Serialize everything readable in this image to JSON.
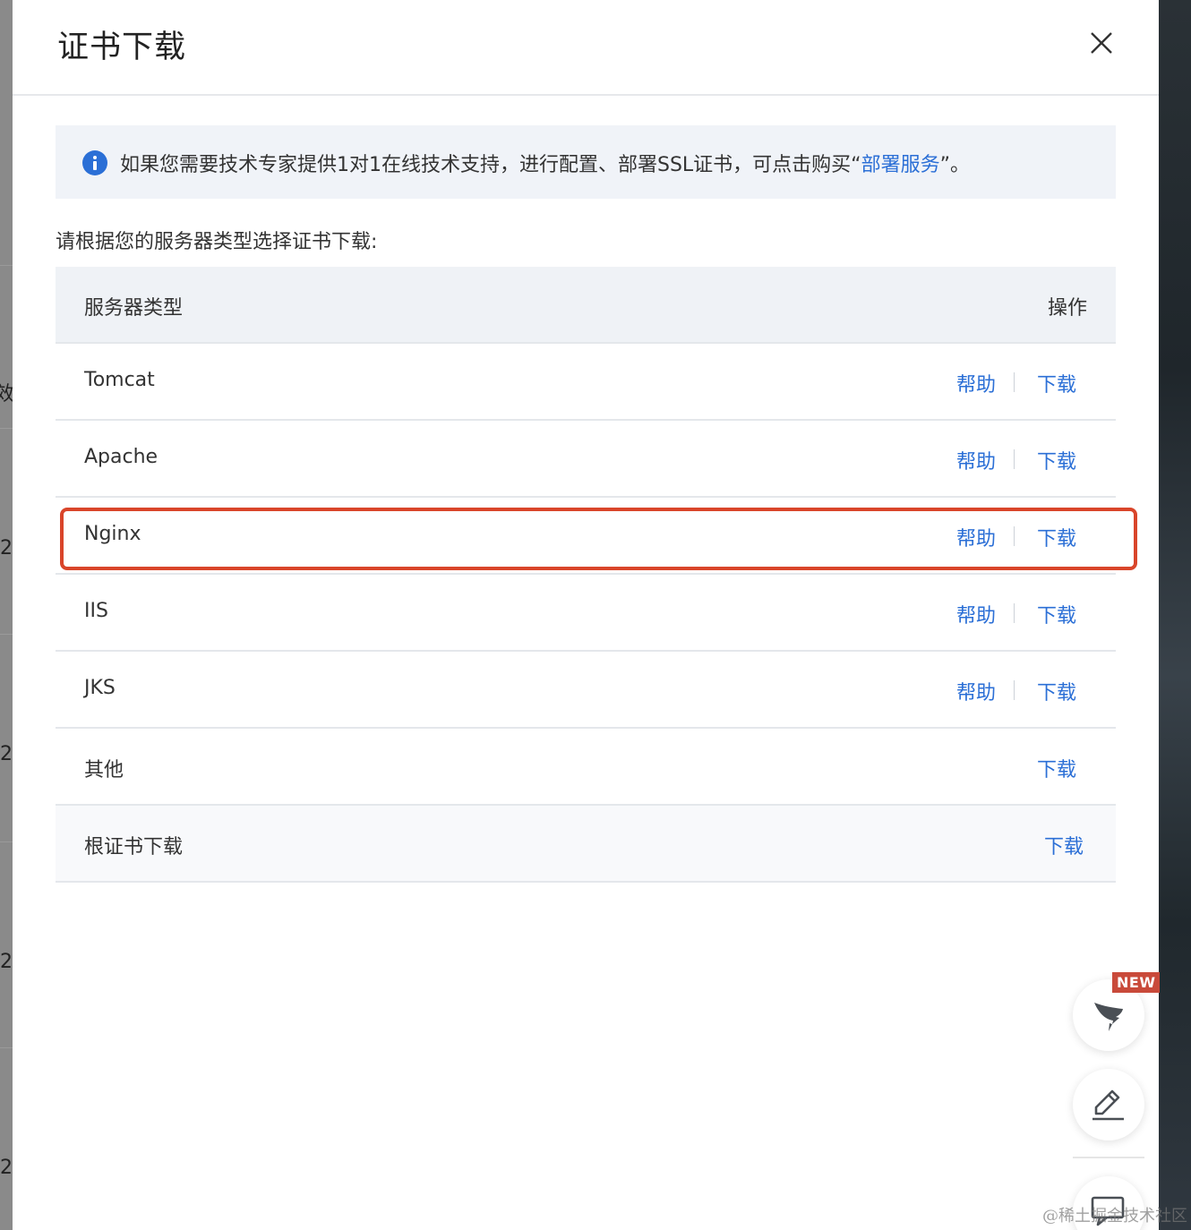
{
  "dialog": {
    "title": "证书下载",
    "notice": {
      "text_before": "如果您需要技术专家提供1对1在线技术支持，进行配置、部署SSL证书，可点击购买“",
      "link": "部署服务",
      "text_after": "”。"
    },
    "instruction": "请根据您的服务器类型选择证书下载:",
    "table": {
      "col_type": "服务器类型",
      "col_action": "操作",
      "rows": [
        {
          "name": "Tomcat",
          "help": "帮助",
          "download": "下载"
        },
        {
          "name": "Apache",
          "help": "帮助",
          "download": "下载"
        },
        {
          "name": "Nginx",
          "help": "帮助",
          "download": "下载"
        },
        {
          "name": "IIS",
          "help": "帮助",
          "download": "下载"
        },
        {
          "name": "JKS",
          "help": "帮助",
          "download": "下载"
        },
        {
          "name": "其他",
          "download": "下载"
        },
        {
          "name": "根证书下载",
          "download": "下载"
        }
      ]
    }
  },
  "float_buttons": {
    "new_badge": "NEW",
    "icons": [
      "dingtalk-icon",
      "edit-icon",
      "feedback-icon"
    ]
  },
  "background_fragments": [
    "效",
    "2",
    "2",
    "2",
    "2"
  ],
  "watermark": "@稀土掘金技术社区",
  "colors": {
    "link": "#2b6fd6",
    "highlight": "#d9452a",
    "badge": "#c94a3a"
  }
}
